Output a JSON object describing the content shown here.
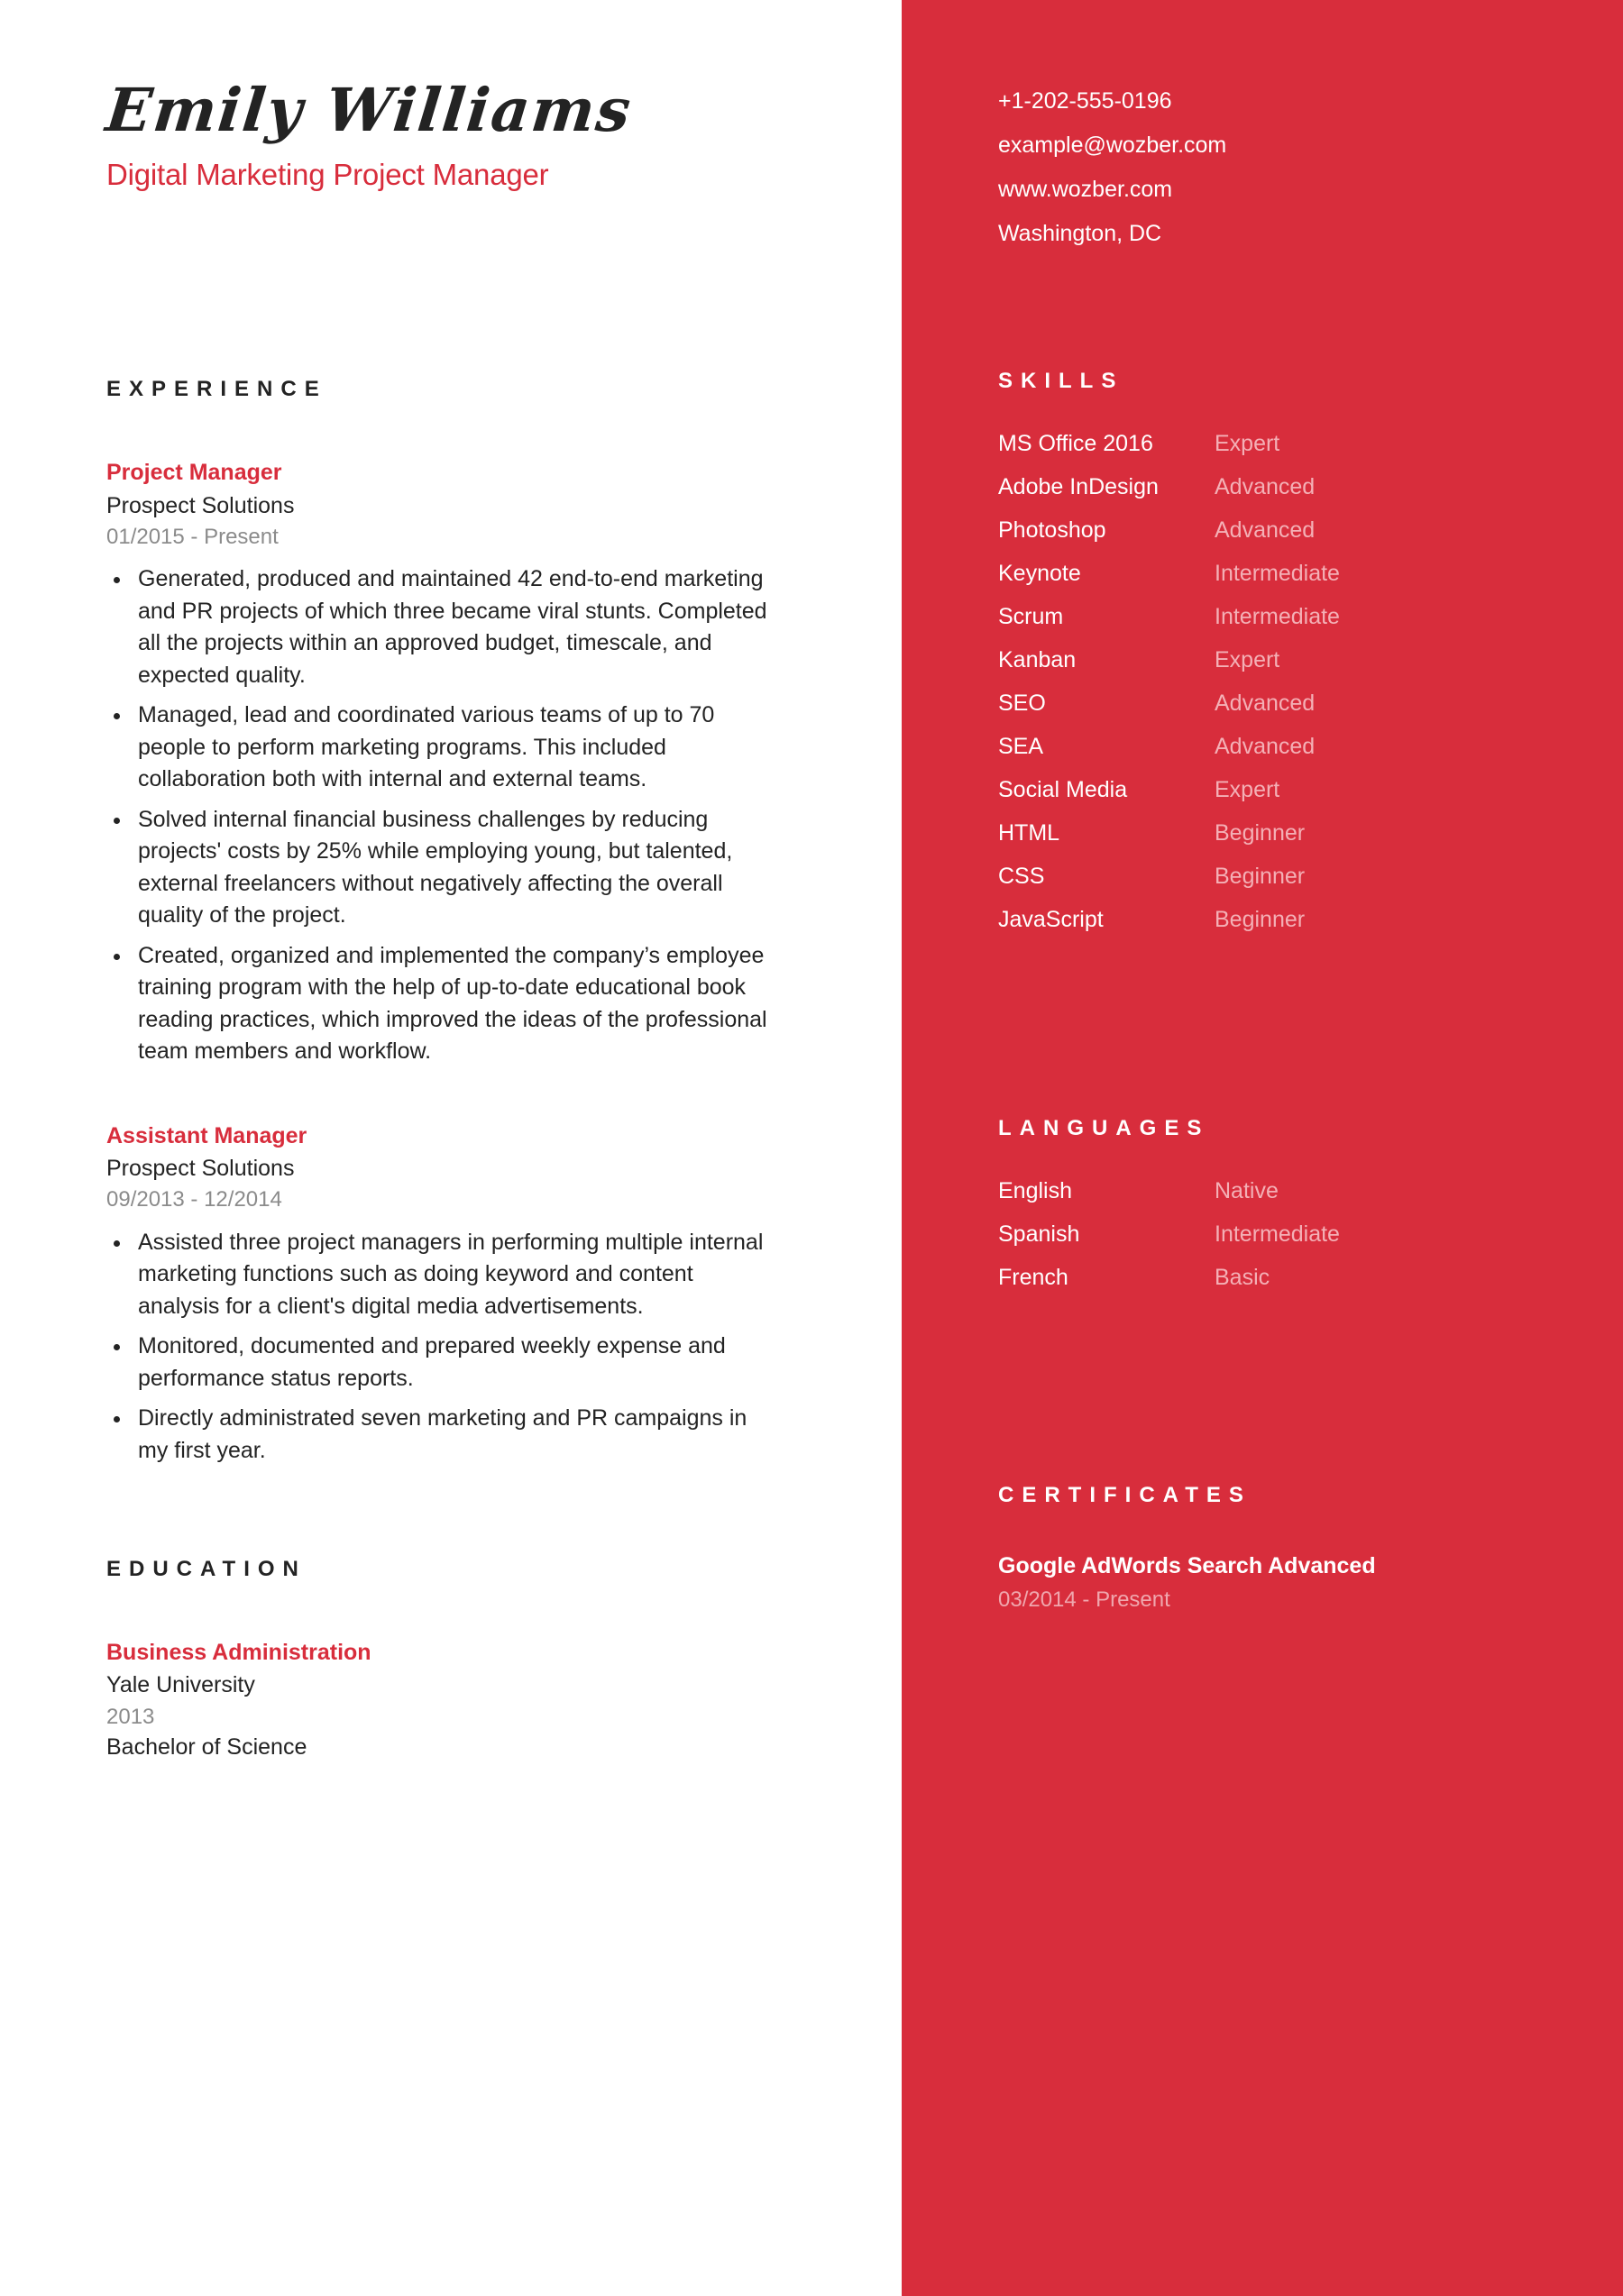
{
  "theme": {
    "accent_red": "#D82D3C",
    "text_dark": "#232323",
    "muted_gray": "#8b8b8b",
    "muted_pink": "#F4B0B6"
  },
  "header": {
    "name": "Emily Williams",
    "job_title": "Digital Marketing Project Manager"
  },
  "contact": {
    "phone": "+1-202-555-0196",
    "email": "example@wozber.com",
    "website": "www.wozber.com",
    "location": "Washington, DC"
  },
  "sections": {
    "experience_heading": "EXPERIENCE",
    "education_heading": "EDUCATION",
    "skills_heading": "SKILLS",
    "languages_heading": "LANGUAGES",
    "certificates_heading": "CERTIFICATES"
  },
  "experience": [
    {
      "title": "Project Manager",
      "organization": "Prospect Solutions",
      "dates": "01/2015 - Present",
      "bullets": [
        "Generated, produced and maintained 42 end-to-end marketing and PR projects of which three became viral stunts. Completed all the projects within an approved budget, timescale, and expected quality.",
        "Managed, lead and coordinated various teams of up to 70 people to perform marketing programs. This included collaboration both with internal and external teams.",
        "Solved internal financial business challenges by reducing projects' costs by 25% while employing young, but talented, external freelancers without negatively affecting the overall quality of the project.",
        "Created, organized and implemented the company’s employee training program with the help of up-to-date educational book reading practices, which improved the ideas of the professional team members and workflow."
      ]
    },
    {
      "title": "Assistant Manager",
      "organization": "Prospect Solutions",
      "dates": "09/2013 - 12/2014",
      "bullets": [
        "Assisted three project managers in performing multiple internal marketing functions such as doing keyword and content analysis for a client's digital media advertisements.",
        "Monitored, documented and prepared weekly expense and performance status reports.",
        "Directly administrated seven marketing and PR campaigns in my first year."
      ]
    }
  ],
  "education": [
    {
      "title": "Business Administration",
      "organization": "Yale University",
      "dates": "2013",
      "degree": "Bachelor of Science"
    }
  ],
  "skills": [
    {
      "name": "MS Office 2016",
      "level": "Expert"
    },
    {
      "name": "Adobe InDesign",
      "level": "Advanced"
    },
    {
      "name": "Photoshop",
      "level": "Advanced"
    },
    {
      "name": "Keynote",
      "level": "Intermediate"
    },
    {
      "name": "Scrum",
      "level": "Intermediate"
    },
    {
      "name": "Kanban",
      "level": "Expert"
    },
    {
      "name": "SEO",
      "level": "Advanced"
    },
    {
      "name": "SEA",
      "level": "Advanced"
    },
    {
      "name": "Social Media",
      "level": "Expert"
    },
    {
      "name": "HTML",
      "level": "Beginner"
    },
    {
      "name": "CSS",
      "level": "Beginner"
    },
    {
      "name": "JavaScript",
      "level": "Beginner"
    }
  ],
  "languages": [
    {
      "name": "English",
      "level": "Native"
    },
    {
      "name": "Spanish",
      "level": "Intermediate"
    },
    {
      "name": "French",
      "level": "Basic"
    }
  ],
  "certificates": [
    {
      "title": "Google AdWords Search Advanced",
      "dates": "03/2014 - Present"
    }
  ]
}
